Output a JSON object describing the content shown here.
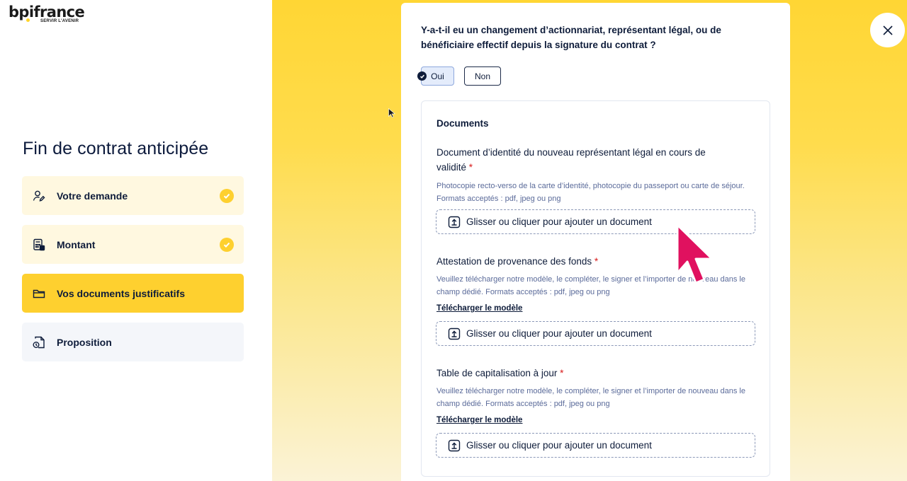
{
  "brand": {
    "name": "bpifrance",
    "tagline": "SERVIR L'AVENIR"
  },
  "sidebar": {
    "title": "Fin de contrat anticipée",
    "steps": [
      {
        "label": "Votre demande",
        "state": "done",
        "icon": "user-edit-icon"
      },
      {
        "label": "Montant",
        "state": "done",
        "icon": "calculator-icon"
      },
      {
        "label": "Vos documents justificatifs",
        "state": "active",
        "icon": "folder-icon"
      },
      {
        "label": "Proposition",
        "state": "pending",
        "icon": "document-clock-icon"
      }
    ]
  },
  "form": {
    "question": "Y-a-t-il eu un changement d’actionnariat, représentant légal, ou de bénéficiaire effectif depuis la signature du contrat ?",
    "choices": {
      "yes": "Oui",
      "no": "Non",
      "selected": "Oui"
    },
    "documents_title": "Documents",
    "fields": [
      {
        "label": "Document d’identité du nouveau représentant légal en cours de validité",
        "required_mark": "*",
        "help": "Photocopie recto-verso de la carte d’identité, photocopie du passeport ou carte de séjour. Formats acceptés : pdf, jpeg ou png",
        "dropzone": "Glisser ou cliquer pour ajouter un document"
      },
      {
        "label": "Attestation de provenance des fonds",
        "required_mark": "*",
        "help": "Veuillez télécharger notre modèle, le compléter, le signer et l’importer de nouveau dans le champ dédié. Formats acceptés : pdf, jpeg ou png",
        "template_link": "Télécharger le modèle",
        "dropzone": "Glisser ou cliquer pour ajouter un document"
      },
      {
        "label": "Table de capitalisation à jour",
        "required_mark": "*",
        "help": "Veuillez télécharger notre modèle, le compléter, le signer et l’importer de nouveau dans le champ dédié. Formats acceptés : pdf, jpeg ou png",
        "template_link": "Télécharger le modèle",
        "dropzone": "Glisser ou cliquer pour ajouter un document"
      }
    ]
  },
  "colors": {
    "accent_yellow": "#fed02f",
    "navy": "#0e1c3a",
    "required_red": "#d81a1a",
    "cursor_pink": "#e0115f"
  }
}
